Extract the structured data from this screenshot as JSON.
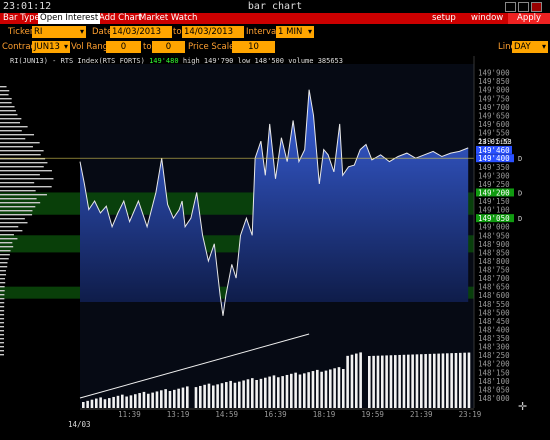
{
  "window": {
    "clock": "23:01:12",
    "title": "bar chart"
  },
  "menu": {
    "bar_type": "Bar Type",
    "open_interest": "Open Interest",
    "add_chart": "Add Chart",
    "market_watch": "Market Watch",
    "setup": "setup",
    "window": "window",
    "apply": "Apply"
  },
  "controls": {
    "ticker_label": "Ticker",
    "ticker_value": "RI",
    "date_label": "Date",
    "date_from": "14/03/2013",
    "to_label": "to",
    "date_to": "14/03/2013",
    "interval_label": "Interval",
    "interval_value": "1 MIN",
    "contract_label": "Contract",
    "contract_value": "JUN13",
    "vol_range_label": "Vol Range",
    "vol_from": "0",
    "vol_to_label": "to",
    "vol_to": "0",
    "price_scale_label": "Price Scale",
    "price_scale_value": "10",
    "line_label": "Line",
    "line_value": "DAY"
  },
  "chart_header": {
    "symbol": "RI(JUN13) - RTS Index(RTS FORTS)",
    "last": "149'480",
    "high": "high 149'790",
    "low": "low 148'500",
    "volume": "volume 385653"
  },
  "colors": {
    "menu_bg": "#cc0000",
    "field_bg": "#ffa500",
    "label": "#ffa030",
    "price_fill": "#3a62e0",
    "band": "#0a4a0a",
    "marker_blue": "#2a50ff",
    "marker_green": "#109a10"
  },
  "chart_data": {
    "type": "area",
    "date_label": "14/03",
    "price_labels": [
      "149'900",
      "149'850",
      "149'800",
      "149'750",
      "149'700",
      "149'650",
      "149'600",
      "149'550",
      "149'500",
      "149'450",
      "149'400",
      "149'350",
      "149'300",
      "149'250",
      "149'200",
      "149'150",
      "149'100",
      "149'050",
      "149'000",
      "148'950",
      "148'900",
      "148'850",
      "148'800",
      "148'750",
      "148'700",
      "148'650",
      "148'600",
      "148'550",
      "148'500",
      "148'450",
      "148'400",
      "148'350",
      "148'300",
      "148'250",
      "148'200",
      "148'150",
      "148'100",
      "148'050",
      "148'000"
    ],
    "time_labels": [
      "11:39",
      "13:19",
      "14:59",
      "16:39",
      "18:19",
      "19:59",
      "21:39",
      "23:19"
    ],
    "time_values_hours": [
      11.65,
      13.317,
      14.983,
      16.65,
      18.317,
      19.983,
      21.65,
      23.317
    ],
    "x_start_hours": 10.0,
    "x_end_hours": 23.5,
    "y_range": [
      148000,
      149950
    ],
    "price_series": {
      "x_hours": [
        10.0,
        10.15,
        10.3,
        10.5,
        10.7,
        10.9,
        11.1,
        11.3,
        11.5,
        11.7,
        12.0,
        12.3,
        12.6,
        12.8,
        13.0,
        13.2,
        13.4,
        13.5,
        13.6,
        13.8,
        14.0,
        14.2,
        14.4,
        14.6,
        14.8,
        14.9,
        15.0,
        15.2,
        15.35,
        15.5,
        15.7,
        15.9,
        16.0,
        16.2,
        16.35,
        16.5,
        16.7,
        16.9,
        17.1,
        17.3,
        17.5,
        17.7,
        17.85,
        18.0,
        18.2,
        18.35,
        18.5,
        18.7,
        18.9,
        19.0,
        19.2,
        19.4,
        19.6,
        19.8,
        20.0,
        20.3,
        20.6,
        20.9,
        21.2,
        21.5,
        21.8,
        22.1,
        22.4,
        22.7,
        23.0,
        23.3
      ],
      "y_values": [
        149380,
        149250,
        149100,
        149150,
        149080,
        149120,
        149000,
        149080,
        149150,
        149030,
        149150,
        149000,
        149200,
        149400,
        149130,
        149050,
        149100,
        149150,
        149000,
        149050,
        149200,
        148950,
        148800,
        148900,
        148600,
        148480,
        148600,
        148780,
        148700,
        148950,
        149050,
        148950,
        149400,
        149500,
        149300,
        149600,
        149280,
        149520,
        149380,
        149620,
        149380,
        149450,
        149800,
        149650,
        149250,
        149450,
        149420,
        149320,
        149600,
        149300,
        149350,
        149360,
        149450,
        149480,
        149390,
        149420,
        149380,
        149410,
        149430,
        149400,
        149420,
        149440,
        149410,
        149430,
        149440,
        149460
      ]
    },
    "last_price_tag": {
      "time": "23:01:53",
      "value": "149'460"
    },
    "price_markers": [
      {
        "value": "149'400",
        "y_value": 149400,
        "color": "blue"
      },
      {
        "value": "149'200",
        "y_value": 149200,
        "color": "green"
      },
      {
        "value": "149'050",
        "y_value": 149050,
        "color": "green"
      }
    ],
    "marker_suffix": "D",
    "green_bands": [
      [
        149070,
        149200
      ],
      [
        148850,
        148950
      ],
      [
        148580,
        148650
      ]
    ],
    "volume_note": "cumulative volume bars rising from left to right"
  }
}
